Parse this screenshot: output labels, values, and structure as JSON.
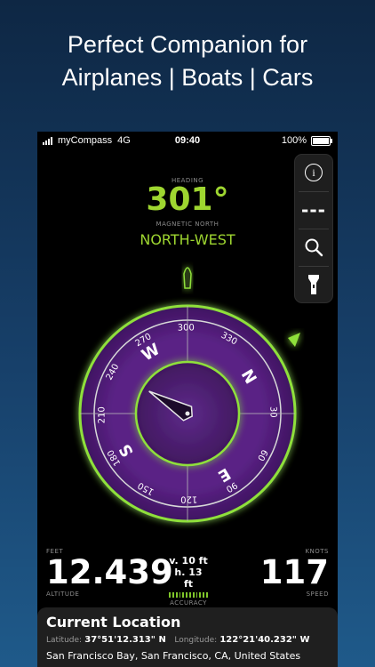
{
  "headline": {
    "line1": "Perfect Companion for",
    "line2": "Airplanes | Boats | Cars"
  },
  "status": {
    "carrier": "myCompass",
    "network": "4G",
    "time": "09:40",
    "battery": "100%"
  },
  "heading": {
    "label": "HEADING",
    "value": "301°",
    "reference_label": "MAGNETIC NORTH",
    "direction": "NORTH-WEST"
  },
  "side_panel": {
    "icons": [
      "info-icon",
      "dashes-icon",
      "search-icon",
      "flashlight-icon"
    ],
    "info_glyph": "i",
    "dashes_text": "---"
  },
  "compass": {
    "heading_deg": 301,
    "cardinals": [
      "N",
      "E",
      "S",
      "W"
    ],
    "degree_labels": [
      "30",
      "60",
      "90",
      "120",
      "150",
      "180",
      "210",
      "240",
      "270",
      "300",
      "330"
    ],
    "ring_color": "#4f1e77",
    "glow_color": "#8fe03a"
  },
  "metrics": {
    "altitude": {
      "unit": "FEET",
      "value": "12.439",
      "label": "ALTITUDE"
    },
    "accuracy": {
      "vertical": "v. 10 ft",
      "horizontal": "h. 13 ft",
      "label": "ACCURACY"
    },
    "speed": {
      "unit": "KNOTS",
      "value": "117",
      "label": "SPEED"
    }
  },
  "location": {
    "title": "Current Location",
    "latitude_label": "Latitude:",
    "latitude": "37°51'12.313\" N",
    "longitude_label": "Longitude:",
    "longitude": "122°21'40.232\" W",
    "address": "San Francisco Bay, San Francisco, CA, United States"
  }
}
